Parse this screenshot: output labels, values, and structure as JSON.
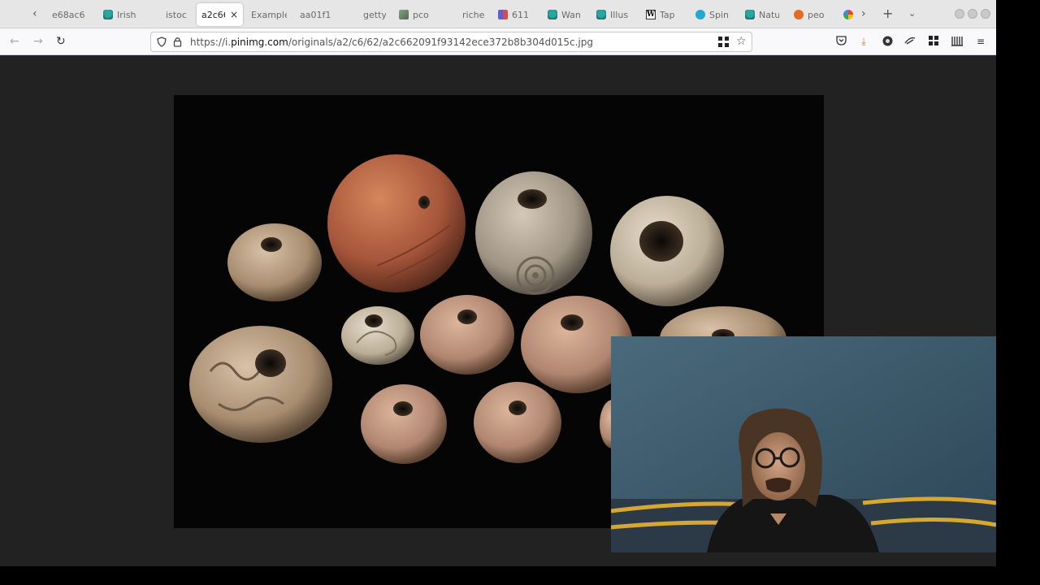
{
  "browser": {
    "tabs": [
      {
        "label": "e68ac6",
        "icon": "none"
      },
      {
        "label": "Irish",
        "icon": "teal-vase-icon"
      },
      {
        "label": "istoc",
        "icon": "none"
      },
      {
        "label": "a2c66",
        "icon": "none",
        "active": true
      },
      {
        "label": "Example",
        "icon": "none"
      },
      {
        "label": "aa01f1",
        "icon": "none"
      },
      {
        "label": "getty",
        "icon": "none"
      },
      {
        "label": "pco",
        "icon": "picture-icon"
      },
      {
        "label": "riche",
        "icon": "none"
      },
      {
        "label": "611",
        "icon": "flickr-icon"
      },
      {
        "label": "Wan",
        "icon": "teal-vase-icon"
      },
      {
        "label": "Illus",
        "icon": "teal-vase-icon"
      },
      {
        "label": "Tap",
        "icon": "wikipedia-icon"
      },
      {
        "label": "Spin",
        "icon": "wordpress-icon"
      },
      {
        "label": "Natu",
        "icon": "teal-vase-icon"
      },
      {
        "label": "peo",
        "icon": "duckduckgo-icon"
      },
      {
        "label": "",
        "icon": "google-icon"
      }
    ],
    "active_close_glyph": "×",
    "wiki_glyph": "W",
    "url": {
      "prefix": "https://i.",
      "host": "pinimg.com",
      "path": "/originals/a2/c6/62/a2c662091f93142ece372b8b304d015c.jpg"
    },
    "colors": {
      "tabstrip": "#e6e6e6",
      "viewer_bg": "#222222",
      "photo_bg": "#000000"
    }
  }
}
